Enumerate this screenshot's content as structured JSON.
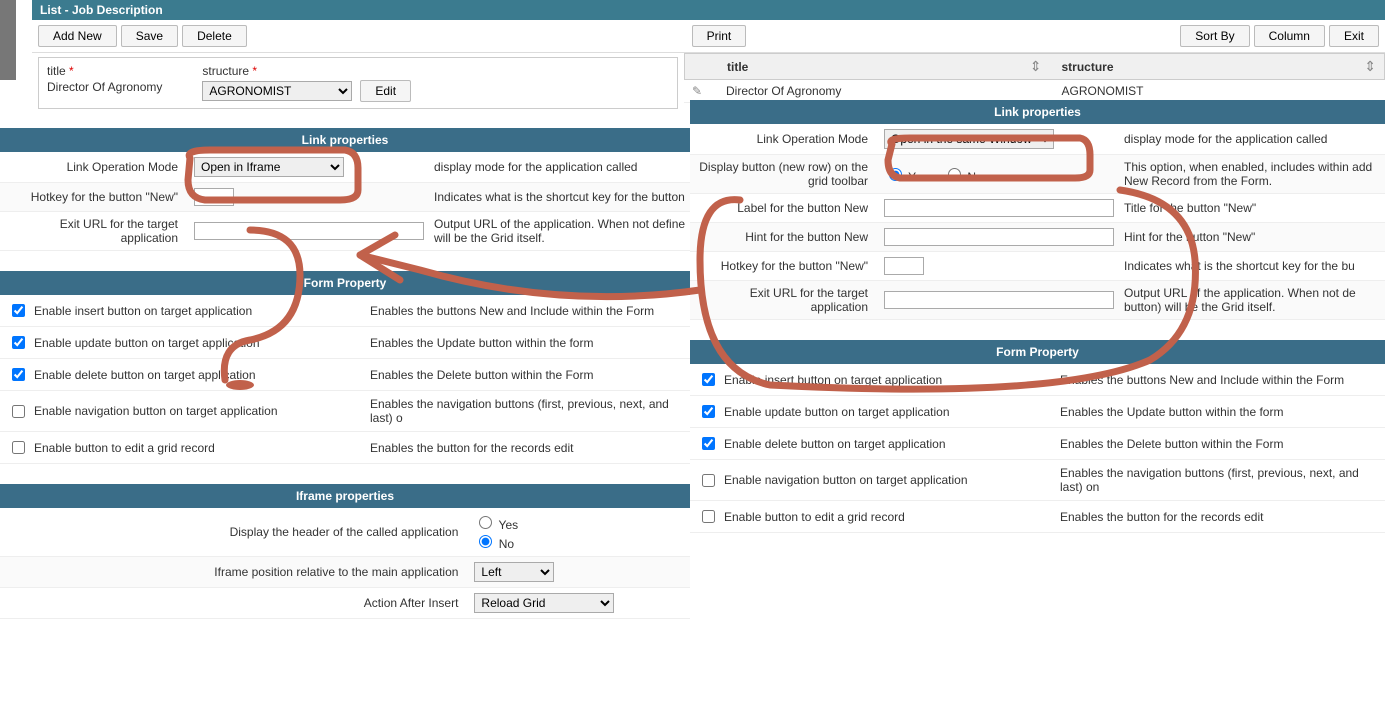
{
  "titlebar": {
    "text": "List - Job Description"
  },
  "toolbar": {
    "add_new": "Add New",
    "save": "Save",
    "delete": "Delete",
    "print": "Print",
    "sort_by": "Sort By",
    "column": "Column",
    "exit": "Exit"
  },
  "form": {
    "title_label": "title",
    "title_value": "Director Of Agronomy",
    "structure_label": "structure",
    "structure_value": "AGRONOMIST",
    "edit": "Edit",
    "req": "*"
  },
  "list": {
    "col_title": "title",
    "col_structure": "structure",
    "rows": [
      {
        "title": "Director Of Agronomy",
        "structure": "AGRONOMIST"
      }
    ]
  },
  "left": {
    "linkprops_hdr": "Link properties",
    "op_mode_label": "Link Operation Mode",
    "op_mode_value": "Open in Iframe",
    "op_mode_desc": "display mode for the application called",
    "hotkey_label": "Hotkey for the button \"New\"",
    "hotkey_value": "",
    "hotkey_desc": "Indicates what is the shortcut key for the button",
    "exiturl_label": "Exit URL for the target application",
    "exiturl_value": "",
    "exiturl_desc": "Output URL of the application. When not define will be the Grid itself.",
    "formprop_hdr": "Form Property",
    "chk_insert": "Enable insert button on target application",
    "chk_insert_desc": "Enables the buttons New and Include within the Form",
    "chk_update": "Enable update button on target application",
    "chk_update_desc": "Enables the Update button within the form",
    "chk_delete": "Enable delete button on target application",
    "chk_delete_desc": "Enables the Delete button within the Form",
    "chk_nav": "Enable navigation button on target application",
    "chk_nav_desc": "Enables the navigation buttons (first, previous, next, and last) o",
    "chk_edit": "Enable button to edit a grid record",
    "chk_edit_desc": "Enables the button for the records edit",
    "iframe_hdr": "Iframe properties",
    "iframe_disp_label": "Display the header of the called application",
    "yes": "Yes",
    "no": "No",
    "iframe_pos_label": "Iframe position relative to the main application",
    "iframe_pos_value": "Left",
    "after_insert_label": "Action After Insert",
    "after_insert_value": "Reload Grid"
  },
  "right": {
    "linkprops_hdr": "Link properties",
    "op_mode_label": "Link Operation Mode",
    "op_mode_value": "Open in the same Window",
    "op_mode_desc": "display mode for the application called",
    "dispbtn_label": "Display button (new row) on the grid toolbar",
    "yes": "Yes",
    "no": "No",
    "dispbtn_desc": "This option, when enabled, includes within add New Record from the Form.",
    "labelnew_label": "Label for the button New",
    "labelnew_value": "",
    "labelnew_desc": "Title for the button \"New\"",
    "hintnew_label": "Hint for the button New",
    "hintnew_value": "",
    "hintnew_desc": "Hint for the button \"New\"",
    "hotkey_label": "Hotkey for the button \"New\"",
    "hotkey_value": "",
    "hotkey_desc": "Indicates what is the shortcut key for the bu",
    "exiturl_label": "Exit URL for the target application",
    "exiturl_value": "",
    "exiturl_desc": "Output URL of the application. When not de button) will be the Grid itself.",
    "formprop_hdr": "Form Property",
    "chk_insert": "Enable insert button on target application",
    "chk_insert_desc": "Enables the buttons New and Include within the Form",
    "chk_update": "Enable update button on target application",
    "chk_update_desc": "Enables the Update button within the form",
    "chk_delete": "Enable delete button on target application",
    "chk_delete_desc": "Enables the Delete button within the Form",
    "chk_nav": "Enable navigation button on target application",
    "chk_nav_desc": "Enables the navigation buttons (first, previous, next, and last) on",
    "chk_edit": "Enable button to edit a grid record",
    "chk_edit_desc": "Enables the button for the records edit"
  }
}
